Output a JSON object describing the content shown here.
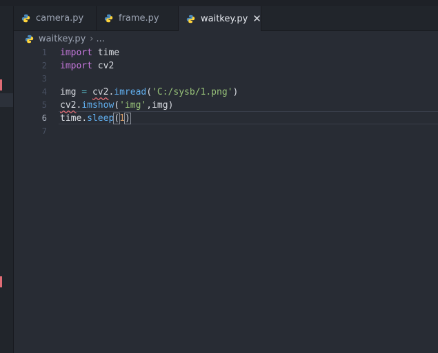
{
  "tabs": [
    {
      "label": "camera.py",
      "active": false
    },
    {
      "label": "frame.py",
      "active": false
    },
    {
      "label": "waitkey.py",
      "active": true
    }
  ],
  "close_glyph": "✕",
  "breadcrumb": {
    "file": "waitkey.py",
    "separator": "›",
    "rest": "..."
  },
  "line_numbers": [
    "1",
    "2",
    "3",
    "4",
    "5",
    "6",
    "7"
  ],
  "code": {
    "l1": {
      "kw": "import",
      "mod": " time"
    },
    "l2": {
      "kw": "import",
      "mod": " cv2"
    },
    "l4": {
      "var": "img",
      "eq": " = ",
      "obj": "cv2",
      "dot": ".",
      "fn": "imread",
      "open": "(",
      "str": "'C:/sysb/1.png'",
      "close": ")"
    },
    "l5": {
      "obj": "cv2",
      "dot": ".",
      "fn": "imshow",
      "open": "(",
      "str": "'img'",
      "comma": ",img",
      "close": ")"
    },
    "l6": {
      "obj": "time",
      "dot": ".",
      "fn": "sleep",
      "open": "(",
      "num": "1",
      "close": ")"
    }
  },
  "colors": {
    "keyword": "#c678dd",
    "function": "#61afef",
    "string": "#98c379",
    "number": "#d19a66",
    "error": "#e06c75"
  },
  "icons": {
    "tab_icon": "python-icon",
    "breadcrumb_icon": "python-icon"
  }
}
